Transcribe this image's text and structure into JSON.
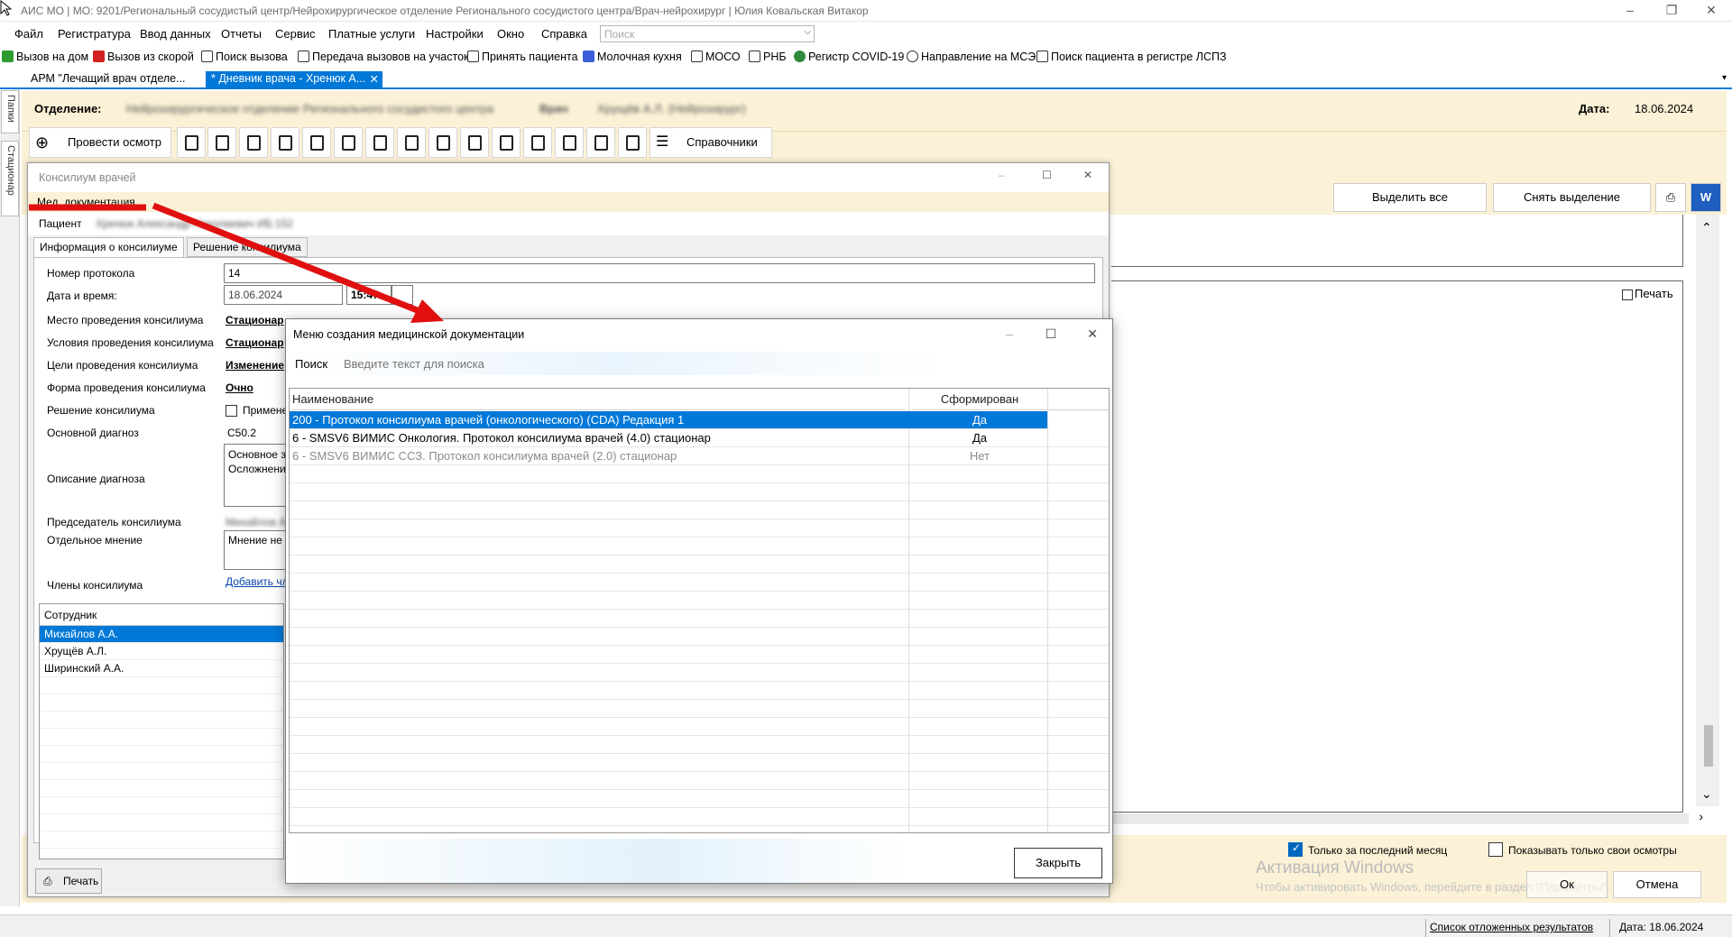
{
  "window": {
    "title": "АИС МО | МО: 9201/Региональный сосудистый центр/Нейрохирургическое отделение Регионального сосудистого центра/Врач-нейрохирург | Юлия Ковальская Витакор"
  },
  "menu": {
    "items": [
      "Файл",
      "Регистратура",
      "Ввод данных",
      "Отчеты",
      "Сервис",
      "Платные услуги",
      "Настройки",
      "Окно",
      "Справка"
    ],
    "search_placeholder": "Поиск"
  },
  "quickbar": {
    "items": [
      "Вызов на дом",
      "Вызов из скорой",
      "Поиск вызова",
      "Передача вызовов на участок",
      "Принять пациента",
      "Молочная кухня",
      "МОСО",
      "РНБ",
      "Регистр COVID-19",
      "Направление на МСЭ",
      "Поиск пациента в регистре ЛСПЗ"
    ]
  },
  "tabs": {
    "items": [
      "АРМ \"Лечащий врач отделе...",
      "* Дневник врача - Хренюк А..."
    ],
    "close": "✕"
  },
  "sidebar": {
    "tabs": [
      "Папки",
      "Стационар"
    ]
  },
  "header": {
    "dept_label": "Отделение:",
    "dept_value": "Нейрохирургическое отделение Регионального сосудистого центра",
    "doctor_label": "Врач",
    "doctor_value": "Хрущёв А.Л. (Нейрохирург)",
    "date_label": "Дата:",
    "date_value": "18.06.2024"
  },
  "toolbar": {
    "exam_button": "Провести осмотр",
    "refs_button": "Справочники",
    "select_all": "Выделить все",
    "deselect": "Снять выделение"
  },
  "right_panel": {
    "print_check": "Печать",
    "only_month": "Только за последний месяц",
    "only_own": "Показывать только свои осмотры",
    "ok": "Ок",
    "cancel": "Отмена",
    "win_activate_title": "Активация Windows",
    "win_activate_text": "Чтобы активировать Windows, перейдите в раздел \"Параметры\"."
  },
  "statusbar": {
    "deferred": "Список отложенных результатов",
    "date": "Дата: 18.06.2024"
  },
  "consilium": {
    "title": "Консилиум врачей",
    "med_docs": "Мед. документация",
    "patient_label": "Пациент",
    "patient_value": "Хренюк Александр Николаевич ИБ:152",
    "tab_info": "Информация о консилиуме",
    "tab_decision": "Решение консилиума",
    "fields": {
      "protocol_label": "Номер протокола",
      "protocol_value": "14",
      "datetime_label": "Дата и время:",
      "date_value": "18.06.2024",
      "time_value": "15:47",
      "place_label": "Место проведения консилиума",
      "place_value": "Стационар",
      "conditions_label": "Условия проведения консилиума",
      "conditions_value": "Стационар",
      "goals_label": "Цели проведения консилиума",
      "goals_value": "Изменение",
      "form_label": "Форма проведения консилиума",
      "form_value": "Очно",
      "decision_label": "Решение консилиума",
      "decision_value": "Примене",
      "diag_label": "Основной диагноз",
      "diag_value": "C50.2",
      "desc_label": "Описание диагноза",
      "desc_line1": "Основное з",
      "desc_line2": "Осложнени",
      "chair_label": "Председатель консилиума",
      "chair_value": "Михайлов А.А.",
      "opinion_label": "Отдельное мнение",
      "opinion_value": "Мнение не",
      "members_label": "Члены консилиума",
      "add_member": "Добавить чл"
    },
    "members": {
      "header": "Сотрудник",
      "rows": [
        "Михайлов А.А.",
        "Хрущёв А.Л.",
        "Ширинский А.А."
      ]
    },
    "print_button": "Печать"
  },
  "dialog": {
    "title": "Меню создания медицинской документации",
    "search_label": "Поиск",
    "search_placeholder": "Введите текст для поиска",
    "col_name": "Наименование",
    "col_formed": "Сформирован",
    "rows": [
      {
        "name": "200 - Протокол консилиума врачей (онкологического) (CDA) Редакция 1",
        "formed": "Да"
      },
      {
        "name": "6 - SMSV6 ВИМИС Онкология. Протокол консилиума врачей (4.0) стационар",
        "formed": "Да"
      },
      {
        "name": "6 - SMSV6 ВИМИС ССЗ. Протокол консилиума врачей (2.0)  стационар",
        "formed": "Нет"
      }
    ],
    "close_button": "Закрыть"
  },
  "colors": {
    "accent": "#0078d7",
    "band": "#fbf1d6",
    "annotation": "#e01010"
  }
}
